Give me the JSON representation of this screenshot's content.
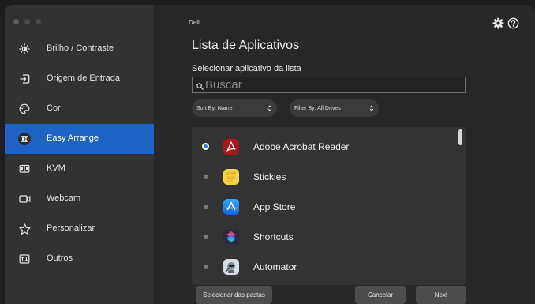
{
  "window": {
    "app_title": "Dell",
    "traffic_light_colors": [
      "#5c5c5c",
      "#4a4a4a",
      "#4a4a4a"
    ]
  },
  "sidebar": {
    "items": [
      {
        "label": "Brilho / Contraste",
        "icon": "brightness-icon",
        "active": false
      },
      {
        "label": "Origem de Entrada",
        "icon": "input-source-icon",
        "active": false
      },
      {
        "label": "Cor",
        "icon": "color-palette-icon",
        "active": false
      },
      {
        "label": "Easy Arrange",
        "icon": "easy-arrange-icon",
        "active": true
      },
      {
        "label": "KVM",
        "icon": "kvm-icon",
        "active": false
      },
      {
        "label": "Webcam",
        "icon": "webcam-icon",
        "active": false
      },
      {
        "label": "Personalizar",
        "icon": "star-icon",
        "active": false
      },
      {
        "label": "Outros",
        "icon": "others-icon",
        "active": false
      }
    ]
  },
  "header": {
    "icons": [
      "settings-gear-icon",
      "help-icon"
    ]
  },
  "main": {
    "title": "Lista de Aplicativos",
    "section_label": "Selecionar aplicativo da lista",
    "search": {
      "placeholder": "Buscar",
      "value": ""
    },
    "sort": {
      "label": "Sort By: Name"
    },
    "filter": {
      "label": "Filter By: All Drives"
    },
    "apps": [
      {
        "name": "Adobe Acrobat Reader",
        "selected": true,
        "icon": "adobe-acrobat-icon"
      },
      {
        "name": "Stickies",
        "selected": false,
        "icon": "stickies-icon"
      },
      {
        "name": "App Store",
        "selected": false,
        "icon": "app-store-icon"
      },
      {
        "name": "Shortcuts",
        "selected": false,
        "icon": "shortcuts-icon"
      },
      {
        "name": "Automator",
        "selected": false,
        "icon": "automator-icon"
      }
    ]
  },
  "footer": {
    "select_folders_label": "Selecionar das pastas",
    "cancel_label": "Cancelar",
    "next_label": "Next"
  },
  "colors": {
    "accent": "#1e63c4",
    "radio_selected": "#2f7df6"
  }
}
